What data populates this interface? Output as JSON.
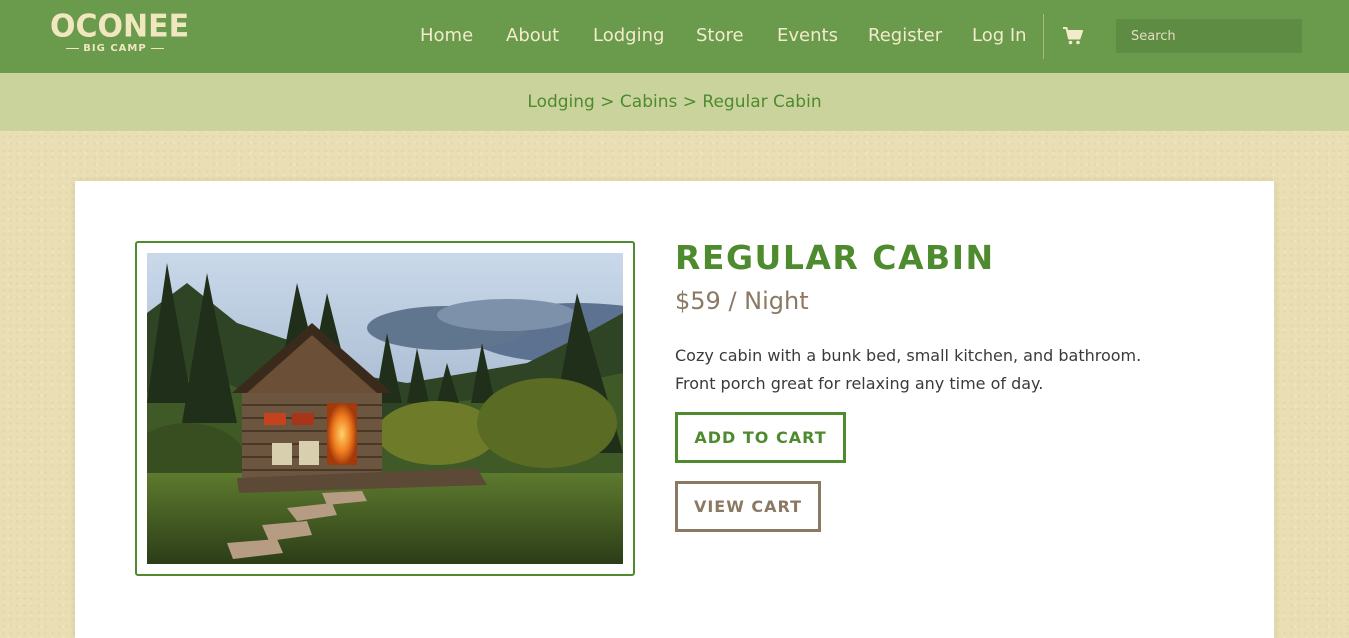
{
  "brand": {
    "name": "OCONEE",
    "tagline": "BIG CAMP"
  },
  "nav": {
    "items": [
      {
        "label": "Home"
      },
      {
        "label": "About"
      },
      {
        "label": "Lodging"
      },
      {
        "label": "Store"
      },
      {
        "label": "Events"
      },
      {
        "label": "Register"
      },
      {
        "label": "Log In"
      }
    ],
    "cart_icon": "shopping-cart-icon",
    "search": {
      "placeholder": "Search",
      "value": ""
    }
  },
  "breadcrumb": {
    "items": [
      "Lodging",
      "Cabins",
      "Regular Cabin"
    ],
    "separator": ">"
  },
  "product": {
    "title": "REGULAR CABIN",
    "price": "$59 / Night",
    "description_line1": "Cozy cabin with a bunk bed, small kitchen, and bathroom.",
    "description_line2": "Front porch great for relaxing any time of day.",
    "add_to_cart_label": "ADD TO CART",
    "view_cart_label": "VIEW CART"
  },
  "colors": {
    "header_bg": "#6a9a4c",
    "breadcrumb_bg": "#cbd39d",
    "accent_green": "#4e8a2e",
    "accent_brown": "#8b7963",
    "page_bg": "#eadfb4"
  }
}
